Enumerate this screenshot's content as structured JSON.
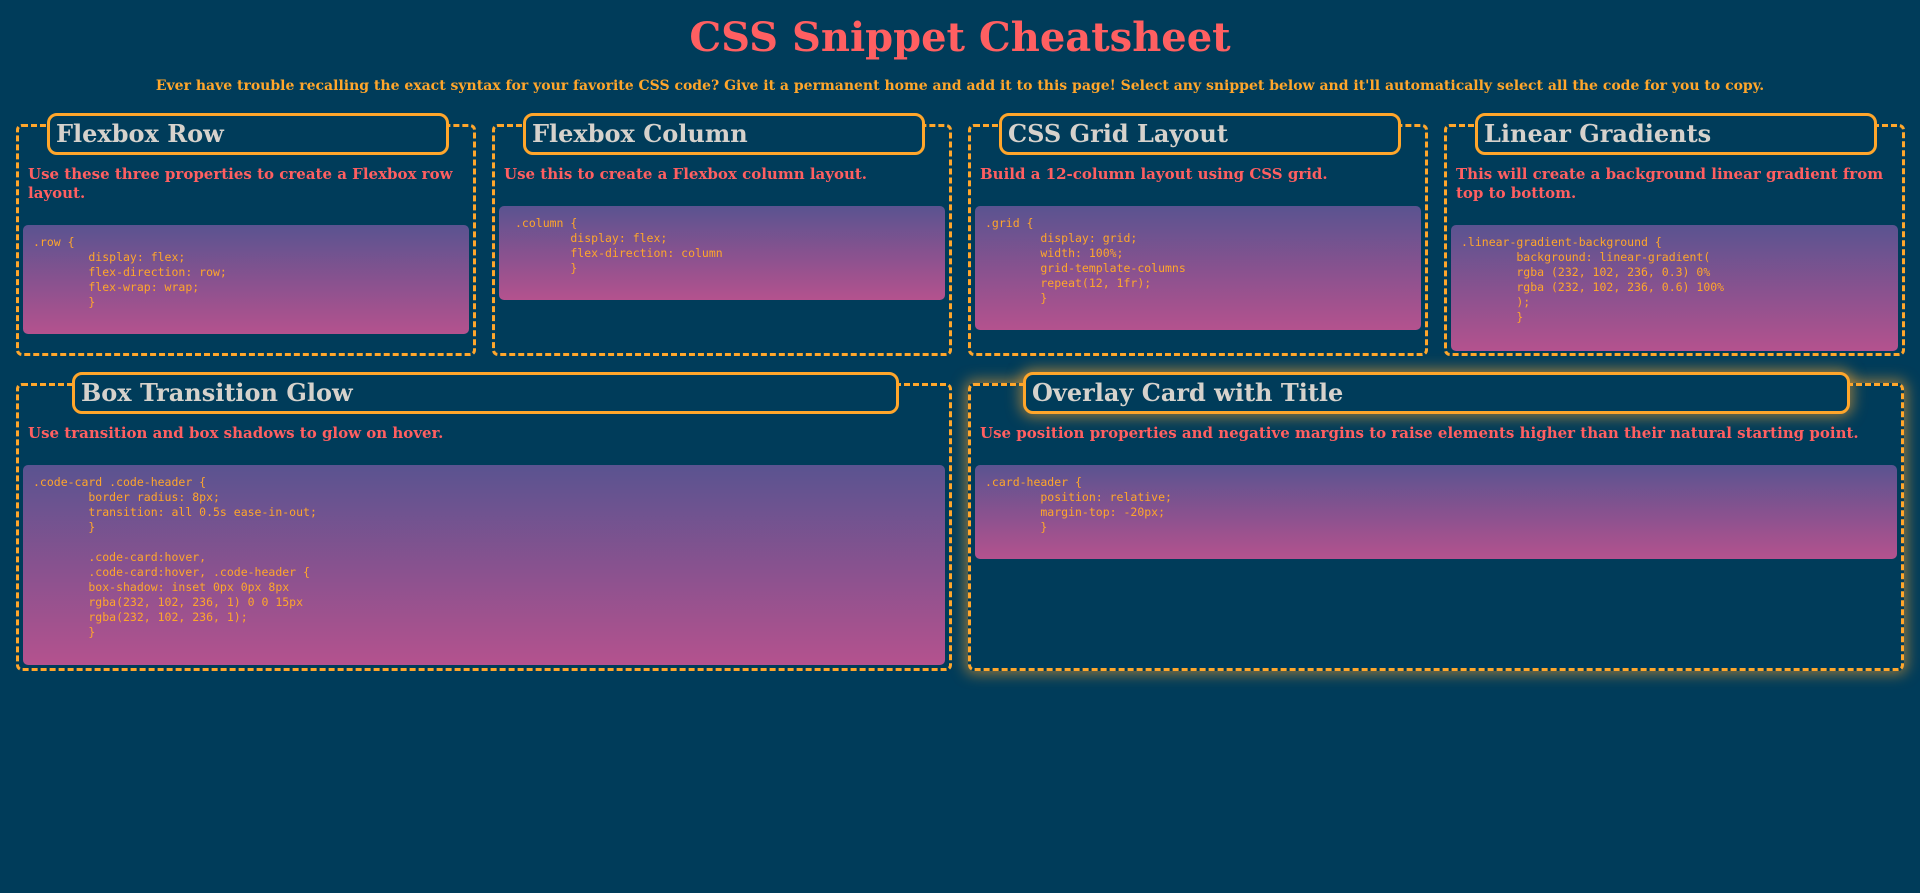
{
  "page": {
    "title": "CSS Snippet Cheatsheet",
    "subtitle": "Ever have trouble recalling the exact syntax for your favorite CSS code? Give it a permanent home and add it to this page! Select any snippet below and it'll automatically select all the code for you to copy."
  },
  "colors": {
    "background": "#003c5a",
    "title": "#ff5f61",
    "accent": "#ffa62b",
    "heading": "#d6d2cc",
    "code_gradient_top": "#5a5390",
    "code_gradient_bottom": "#b4528e"
  },
  "cards": {
    "flexbox_row": {
      "title": "Flexbox Row",
      "description": "Use these three properties to create a Flexbox row layout.",
      "code": ".row {\n        display: flex;\n        flex-direction: row;\n        flex-wrap: wrap;\n        }"
    },
    "flexbox_column": {
      "title": "Flexbox Column",
      "description": "Use this to create a Flexbox column layout.",
      "code": ".column {\n        display: flex;\n        flex-direction: column\n        }"
    },
    "css_grid": {
      "title": "CSS Grid Layout",
      "description": "Build a 12-column layout using CSS grid.",
      "code": ".grid {\n        display: grid;\n        width: 100%;\n        grid-template-columns\n        repeat(12, 1fr);\n        }"
    },
    "linear_gradients": {
      "title": "Linear Gradients",
      "description": "This will create a background linear gradient from top to bottom.",
      "code": ".linear-gradient-background {\n        background: linear-gradient(\n        rgba (232, 102, 236, 0.3) 0%\n        rgba (232, 102, 236, 0.6) 100%\n        );\n        }"
    },
    "box_transition_glow": {
      "title": "Box Transition Glow",
      "description": "Use transition and box shadows to glow on hover.",
      "code": ".code-card .code-header {\n        border radius: 8px;\n        transition: all 0.5s ease-in-out;\n        }\n\n        .code-card:hover,\n        .code-card:hover, .code-header {\n        box-shadow: inset 0px 0px 8px\n        rgba(232, 102, 236, 1) 0 0 15px\n        rgba(232, 102, 236, 1);\n        }"
    },
    "overlay_card": {
      "title": "Overlay Card with Title",
      "description": "Use position properties and negative margins to raise elements higher than their natural starting point.",
      "code": ".card-header {\n        position: relative;\n        margin-top: -20px;\n        }"
    }
  }
}
